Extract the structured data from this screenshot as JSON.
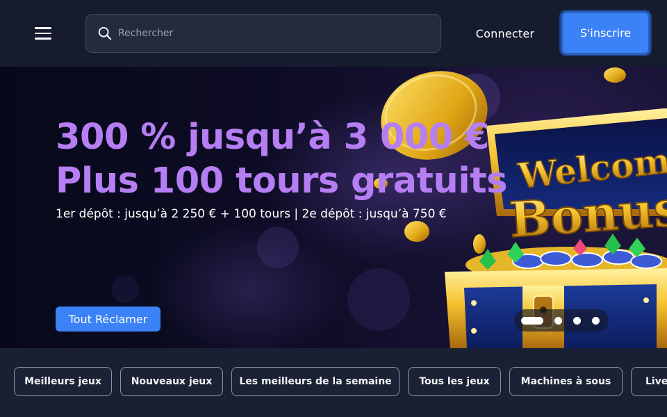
{
  "header": {
    "search_placeholder": "Rechercher",
    "login_label": "Connecter",
    "signup_label": "S'inscrire"
  },
  "banner": {
    "headline_line1": "300 % jusqu’à 3 000 €",
    "headline_line2": "Plus 100 tours gratuits",
    "subline": "1er dépôt : jusqu’à 2 250 € + 100 tours | 2e dépôt : jusqu’à 750 €",
    "cta_label": "Tout Réclamer",
    "art_text_line1": "Welcome",
    "art_text_line2": "Bonus",
    "carousel": {
      "slide_count": 4,
      "active_index": 0
    }
  },
  "categories": [
    "Meilleurs jeux",
    "Nouveaux jeux",
    "Les meilleurs de la semaine",
    "Tous les jeux",
    "Machines à sous",
    "Live"
  ],
  "colors": {
    "accent_blue": "#3b82f6",
    "headline_purple": "#b57ef2",
    "background": "#14192b"
  }
}
